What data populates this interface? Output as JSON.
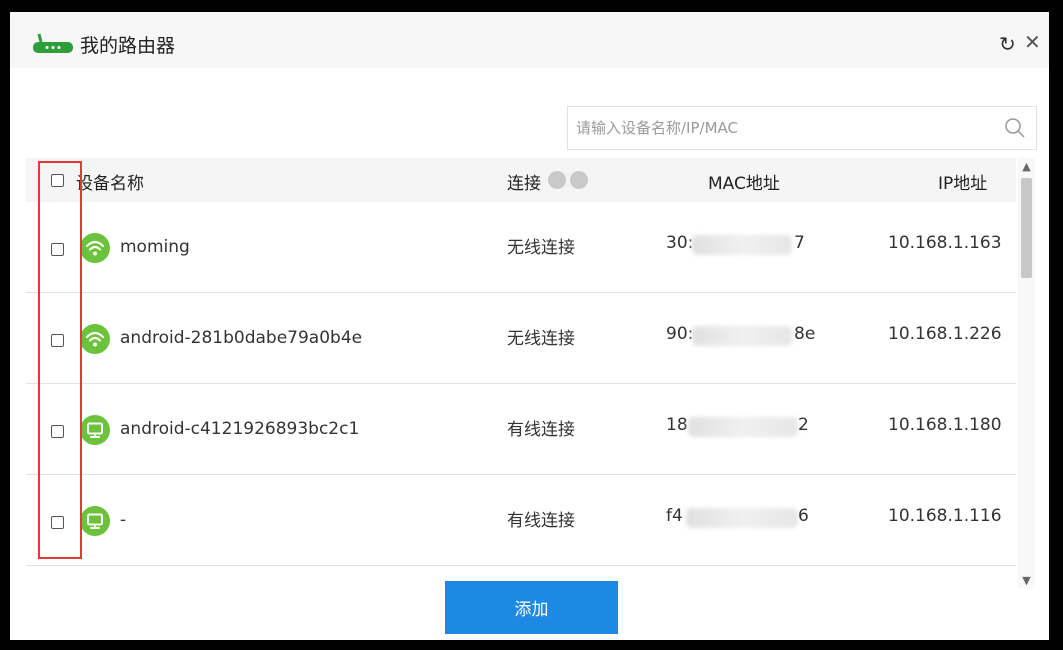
{
  "window": {
    "title": "我的路由器",
    "refresh_icon": "refresh-icon",
    "close_icon": "close-icon",
    "brand_color": "#2e9e3a"
  },
  "search": {
    "placeholder": "请输入设备名称/IP/MAC",
    "value": ""
  },
  "table": {
    "columns": {
      "name": "设备名称",
      "connection": "连接",
      "mac": "MAC地址",
      "ip": "IP地址"
    },
    "rows": [
      {
        "icon": "wifi-icon",
        "name": "moming",
        "connection": "无线连接",
        "mac_prefix": "30:",
        "mac_suffix": "7",
        "ip": "10.168.1.163"
      },
      {
        "icon": "wifi-icon",
        "name": "android-281b0dabe79a0b4e",
        "connection": "无线连接",
        "mac_prefix": "90:",
        "mac_suffix": "8e",
        "ip": "10.168.1.226"
      },
      {
        "icon": "monitor-icon",
        "name": "android-c4121926893bc2c1",
        "connection": "有线连接",
        "mac_prefix": "18",
        "mac_suffix": "2",
        "ip": "10.168.1.180"
      },
      {
        "icon": "monitor-icon",
        "name": "-",
        "connection": "有线连接",
        "mac_prefix": "f4",
        "mac_suffix": "6",
        "ip": "10.168.1.116"
      }
    ]
  },
  "footer": {
    "add_label": "添加"
  },
  "colors": {
    "accent": "#1e88e5",
    "device_icon": "#6cc23a",
    "highlight": "#e53935"
  }
}
